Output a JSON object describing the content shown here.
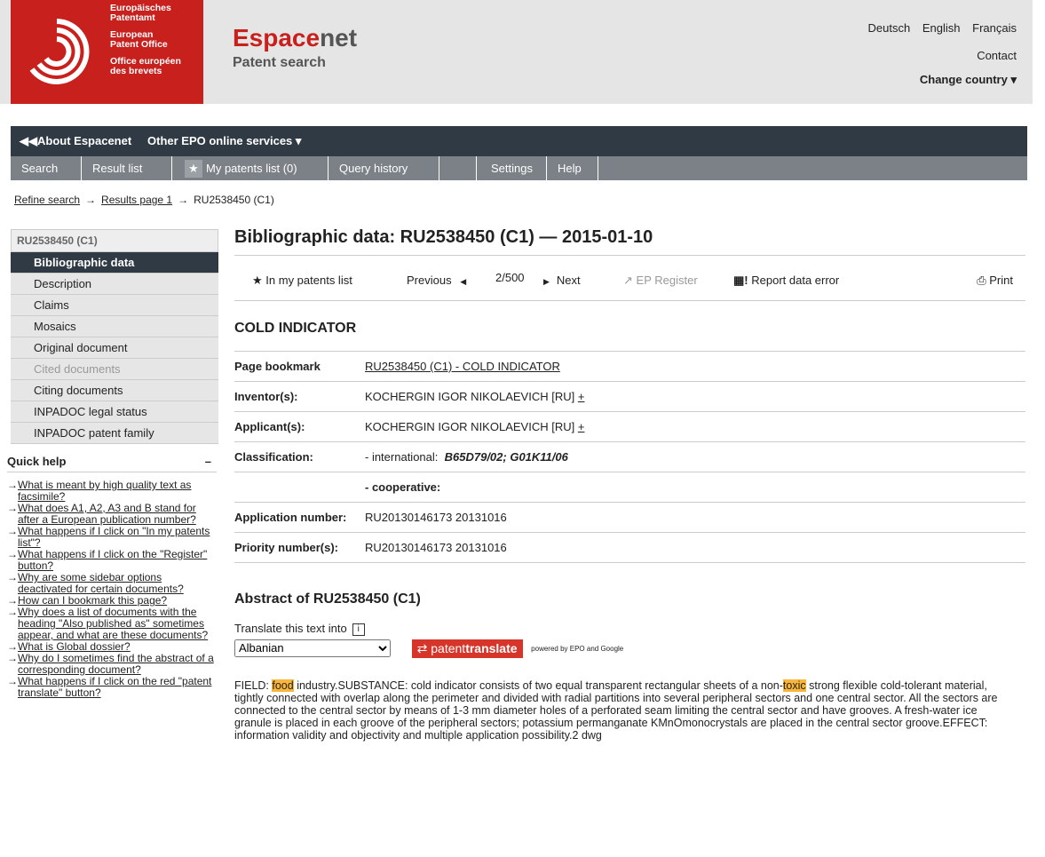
{
  "header": {
    "logo_lines": [
      "Europäisches",
      "Patentamt",
      "European",
      "Patent Office",
      "Office européen",
      "des brevets"
    ],
    "brand": "Espacenet",
    "brand_prefix": "Espace",
    "brand_suffix": "net",
    "subtitle": "Patent search",
    "languages": [
      "Deutsch",
      "English",
      "Français"
    ],
    "contact": "Contact",
    "change_country": "Change country"
  },
  "topnav": {
    "about": "About Espacenet",
    "other": "Other EPO online services"
  },
  "subnav": {
    "tabs": [
      "Search",
      "Result list",
      "My patents list (0)",
      "Query history",
      "",
      "Settings",
      "Help"
    ]
  },
  "breadcrumb": {
    "refine": "Refine search",
    "results": "Results page 1",
    "current": "RU2538450 (C1)"
  },
  "sidebar": {
    "header": "RU2538450 (C1)",
    "items": [
      {
        "label": "Bibliographic data",
        "state": "active"
      },
      {
        "label": "Description",
        "state": "normal"
      },
      {
        "label": "Claims",
        "state": "normal"
      },
      {
        "label": "Mosaics",
        "state": "normal"
      },
      {
        "label": "Original document",
        "state": "normal"
      },
      {
        "label": "Cited documents",
        "state": "disabled"
      },
      {
        "label": "Citing documents",
        "state": "normal"
      },
      {
        "label": "INPADOC legal status",
        "state": "normal"
      },
      {
        "label": "INPADOC patent family",
        "state": "normal"
      }
    ]
  },
  "quick_help": {
    "title": "Quick help",
    "items": [
      "What is meant by high quality text as facsimile?",
      "What does A1, A2, A3 and B stand for after a European publication number?",
      "What happens if I click on \"In my patents list\"?",
      "What happens if I click on the \"Register\" button?",
      "Why are some sidebar options deactivated for certain documents?",
      "How can I bookmark this page?",
      "Why does a list of documents with the heading \"Also published as\" sometimes appear, and what are these documents?",
      "What is Global dossier?",
      "Why do I sometimes find the abstract of a corresponding document?",
      "What happens if I click on the red \"patent translate\" button?"
    ]
  },
  "main": {
    "title": "Bibliographic data: RU2538450 (C1) — 2015-01-10",
    "toolbar": {
      "my_patents": "In my patents list",
      "previous": "Previous",
      "position": "2/500",
      "next": "Next",
      "ep_register": "EP Register",
      "report": "Report data error",
      "print": "Print"
    },
    "doc_title": "COLD INDICATOR",
    "rows": {
      "page_bookmark_label": "Page bookmark",
      "page_bookmark": "RU2538450 (C1)  -  COLD INDICATOR",
      "inventors_label": "Inventor(s):",
      "inventors": "KOCHERGIN IGOR NIKOLAEVICH  [RU]",
      "applicants_label": "Applicant(s):",
      "applicants": "KOCHERGIN IGOR NIKOLAEVICH  [RU]",
      "classification_label": "Classification:",
      "intl_label": "- international:",
      "intl_value": "B65D79/02; G01K11/06",
      "coop_label": "- cooperative:",
      "app_number_label": "Application number:",
      "app_number": "RU20130146173 20131016",
      "priority_label": "Priority number(s):",
      "priority": "RU20130146173 20131016"
    },
    "abstract_heading": "Abstract of  RU2538450 (C1)",
    "translate_label": "Translate this text into",
    "translate_selected": "Albanian",
    "patent_translate_prefix": "patent",
    "patent_translate_suffix": "translate",
    "powered": "powered by EPO and Google",
    "abstract_parts": [
      "FIELD: ",
      "food",
      " industry.SUBSTANCE: cold indicator consists of two equal transparent rectangular sheets of a non-",
      "toxic",
      " strong flexible cold-tolerant material, tightly connected with overlap along the perimeter and divided with radial partitions into several peripheral sectors and one central sector. All the sectors are connected to the central sector by means of 1-3 mm diameter holes of a perforated seam limiting the central sector and have grooves. A fresh-water ice granule is placed in each groove of the peripheral sectors; potassium permanganate KMnOmonocrystals are placed in the central sector groove.EFFECT: information validity and objectivity and multiple application possibility.2 dwg"
    ]
  }
}
